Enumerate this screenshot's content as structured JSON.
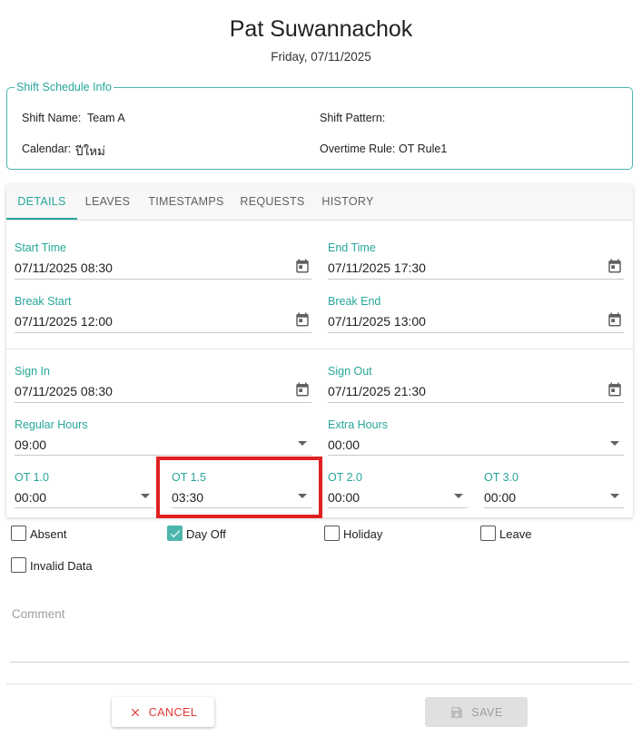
{
  "header": {
    "employee_name": "Pat Suwannachok",
    "date": "Friday, 07/11/2025"
  },
  "shift_info": {
    "legend": "Shift Schedule Info",
    "shift_name_label": "Shift Name:",
    "shift_name_value": "Team A",
    "shift_pattern_label": "Shift Pattern:",
    "shift_pattern_value": "",
    "calendar_label": "Calendar:",
    "calendar_value": "ปีใหม่",
    "overtime_rule_label": "Overtime Rule:",
    "overtime_rule_value": "OT Rule1"
  },
  "tabs": [
    {
      "label": "DETAILS",
      "active": true
    },
    {
      "label": "LEAVES",
      "active": false
    },
    {
      "label": "TIMESTAMPS",
      "active": false
    },
    {
      "label": "REQUESTS",
      "active": false
    },
    {
      "label": "HISTORY",
      "active": false
    }
  ],
  "fields": {
    "start_time": {
      "label": "Start Time",
      "value": "07/11/2025 08:30"
    },
    "end_time": {
      "label": "End Time",
      "value": "07/11/2025 17:30"
    },
    "break_start": {
      "label": "Break Start",
      "value": "07/11/2025 12:00"
    },
    "break_end": {
      "label": "Break End",
      "value": "07/11/2025 13:00"
    },
    "sign_in": {
      "label": "Sign In",
      "value": "07/11/2025 08:30"
    },
    "sign_out": {
      "label": "Sign Out",
      "value": "07/11/2025 21:30"
    },
    "regular_hours": {
      "label": "Regular Hours",
      "value": "09:00"
    },
    "extra_hours": {
      "label": "Extra Hours",
      "value": "00:00"
    },
    "ot_1_0": {
      "label": "OT 1.0",
      "value": "00:00"
    },
    "ot_1_5": {
      "label": "OT 1.5",
      "value": "03:30"
    },
    "ot_2_0": {
      "label": "OT 2.0",
      "value": "00:00"
    },
    "ot_3_0": {
      "label": "OT 3.0",
      "value": "00:00"
    }
  },
  "checkboxes": {
    "absent": {
      "label": "Absent",
      "checked": false
    },
    "day_off": {
      "label": "Day Off",
      "checked": true
    },
    "holiday": {
      "label": "Holiday",
      "checked": false
    },
    "leave": {
      "label": "Leave",
      "checked": false
    },
    "invalid_data": {
      "label": "Invalid Data",
      "checked": false
    }
  },
  "comment": {
    "placeholder": "Comment"
  },
  "actions": {
    "cancel_label": "CANCEL",
    "save_label": "SAVE"
  },
  "colors": {
    "accent": "#26a69a",
    "cancel": "#e53935",
    "highlight": "#e02020",
    "disabled": "#9e9e9e"
  },
  "icons": [
    "calendar-icon",
    "dropdown-caret-icon",
    "close-icon",
    "save-icon",
    "check-icon"
  ]
}
